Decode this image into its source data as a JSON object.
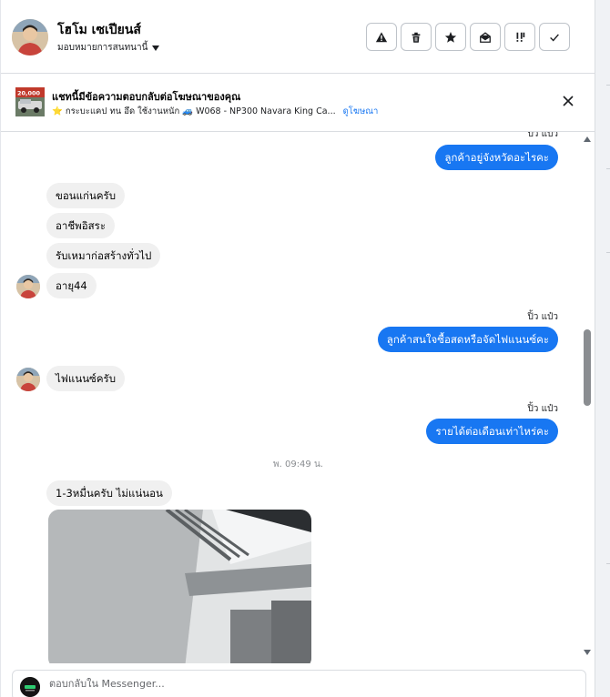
{
  "header": {
    "contact_name": "โฮโม เซเปียนส์",
    "assign_label": "มอบหมายการสนทนานี้",
    "actions": [
      {
        "icon": "warning-icon",
        "name": "spam-button"
      },
      {
        "icon": "trash-icon",
        "name": "delete-button"
      },
      {
        "icon": "star-icon",
        "name": "star-button"
      },
      {
        "icon": "envelope-open-icon",
        "name": "mark-unread-button"
      },
      {
        "icon": "follow-up-icon",
        "name": "follow-up-button"
      },
      {
        "icon": "check-icon",
        "name": "done-button"
      }
    ]
  },
  "ad": {
    "title": "แชทนี้มีข้อความตอบกลับต่อโฆษณาของคุณ",
    "description": "⭐ กระบะแคป ทน อึด ใช้งานหนัก 🚙 W068 - NP300 Navara King Ca...",
    "link": "ดูโฆษณา",
    "thumb_text": "20,000"
  },
  "messages": {
    "meta_top": "ปิ้ว แป๋ว",
    "out1": "ลูกค้าอยู่จังหวัดอะไรคะ",
    "in1": "ขอนแก่นครับ",
    "in2": "อาชีพอิสระ",
    "in3": "รับเหมาก่อสร้างทั่วไป",
    "in4": "อายุ44",
    "meta2": "ปิ้ว แป๋ว",
    "out2": "ลูกค้าสนใจซื้อสดหรือจัดไฟแนนซ์คะ",
    "in5": "ไฟแนนซ์ครับ",
    "meta3": "ปิ้ว แป๋ว",
    "out3": "รายได้ต่อเดือนเท่าไหร่คะ",
    "time_separator": "พ. 09:49 น.",
    "in6": "1-3หมื่นครับ ไม่แน่นอน"
  },
  "composer": {
    "placeholder": "ตอบกลับใน Messenger..."
  },
  "colors": {
    "accent": "#1877f2",
    "incoming_bubble": "#f0f0f0"
  }
}
